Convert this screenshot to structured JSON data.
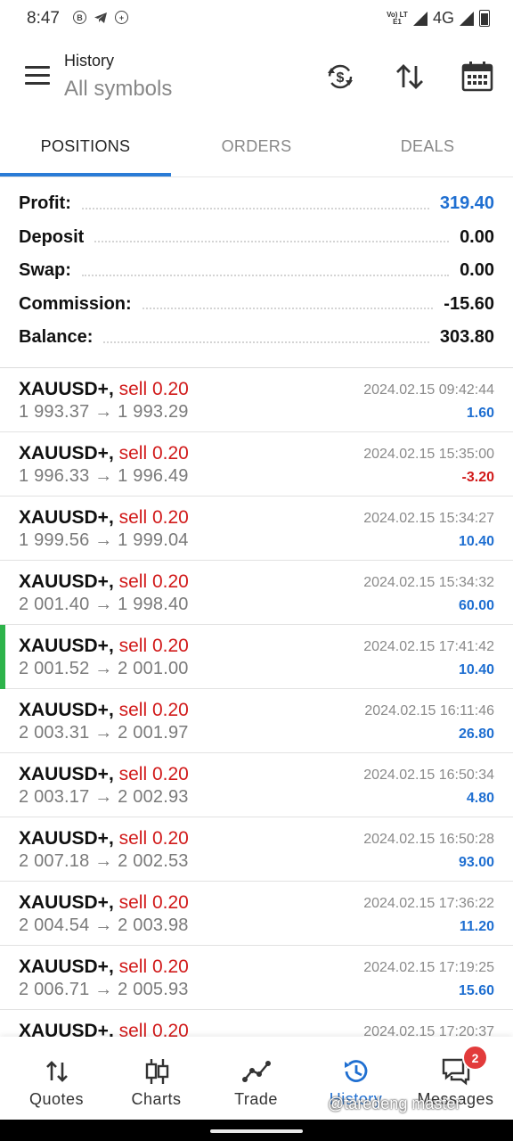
{
  "status_bar": {
    "time": "8:47",
    "network": "4G",
    "volte": "Vo) LTE1",
    "left_icons": [
      "bitcoin-notification-icon",
      "telegram-icon",
      "chat-notification-icon"
    ]
  },
  "app_bar": {
    "title": "History",
    "subtitle": "All symbols",
    "icons": [
      "menu-icon",
      "currency-sync-icon",
      "sort-icon",
      "calendar-icon"
    ]
  },
  "tabs": [
    {
      "label": "POSITIONS",
      "active": true
    },
    {
      "label": "ORDERS",
      "active": false
    },
    {
      "label": "DEALS",
      "active": false
    }
  ],
  "summary": [
    {
      "label": "Profit:",
      "value": "319.40",
      "accent": "#1f6fd1"
    },
    {
      "label": "Deposit",
      "value": "0.00"
    },
    {
      "label": "Swap:",
      "value": "0.00"
    },
    {
      "label": "Commission:",
      "value": "-15.60"
    },
    {
      "label": "Balance:",
      "value": "303.80"
    }
  ],
  "deals": [
    {
      "symbol": "XAUUSD+,",
      "type": "sell 0.20",
      "prices": "1 993.37 → 1 993.29",
      "time": "2024.02.15 09:42:44",
      "profit": "1.60",
      "sign": "pos"
    },
    {
      "symbol": "XAUUSD+,",
      "type": "sell 0.20",
      "prices": "1 996.33 → 1 996.49",
      "time": "2024.02.15 15:35:00",
      "profit": "-3.20",
      "sign": "neg"
    },
    {
      "symbol": "XAUUSD+,",
      "type": "sell 0.20",
      "prices": "1 999.56 → 1 999.04",
      "time": "2024.02.15 15:34:27",
      "profit": "10.40",
      "sign": "pos"
    },
    {
      "symbol": "XAUUSD+,",
      "type": "sell 0.20",
      "prices": "2 001.40 → 1 998.40",
      "time": "2024.02.15 15:34:32",
      "profit": "60.00",
      "sign": "pos"
    },
    {
      "symbol": "XAUUSD+,",
      "type": "sell 0.20",
      "prices": "2 001.52 → 2 001.00",
      "time": "2024.02.15 17:41:42",
      "profit": "10.40",
      "sign": "pos",
      "marked": true
    },
    {
      "symbol": "XAUUSD+,",
      "type": "sell 0.20",
      "prices": "2 003.31 → 2 001.97",
      "time": "2024.02.15 16:11:46",
      "profit": "26.80",
      "sign": "pos"
    },
    {
      "symbol": "XAUUSD+,",
      "type": "sell 0.20",
      "prices": "2 003.17 → 2 002.93",
      "time": "2024.02.15 16:50:34",
      "profit": "4.80",
      "sign": "pos"
    },
    {
      "symbol": "XAUUSD+,",
      "type": "sell 0.20",
      "prices": "2 007.18 → 2 002.53",
      "time": "2024.02.15 16:50:28",
      "profit": "93.00",
      "sign": "pos"
    },
    {
      "symbol": "XAUUSD+,",
      "type": "sell 0.20",
      "prices": "2 004.54 → 2 003.98",
      "time": "2024.02.15 17:36:22",
      "profit": "11.20",
      "sign": "pos"
    },
    {
      "symbol": "XAUUSD+,",
      "type": "sell 0.20",
      "prices": "2 006.71 → 2 005.93",
      "time": "2024.02.15 17:19:25",
      "profit": "15.60",
      "sign": "pos"
    },
    {
      "symbol": "XAUUSD+,",
      "type": "sell 0.20",
      "prices": "",
      "time": "2024.02.15 17:20:37",
      "profit": "",
      "sign": "pos"
    }
  ],
  "bottom_nav": [
    {
      "label": "Quotes",
      "icon": "quotes-icon"
    },
    {
      "label": "Charts",
      "icon": "charts-icon"
    },
    {
      "label": "Trade",
      "icon": "trade-icon"
    },
    {
      "label": "History",
      "icon": "history-icon",
      "active": true
    },
    {
      "label": "Messages",
      "icon": "messages-icon",
      "badge": "2"
    }
  ],
  "watermark": "@taredeng master",
  "colors": {
    "accent": "#1f6fd1",
    "sell": "#d11a1a",
    "marker": "#2db34a"
  }
}
